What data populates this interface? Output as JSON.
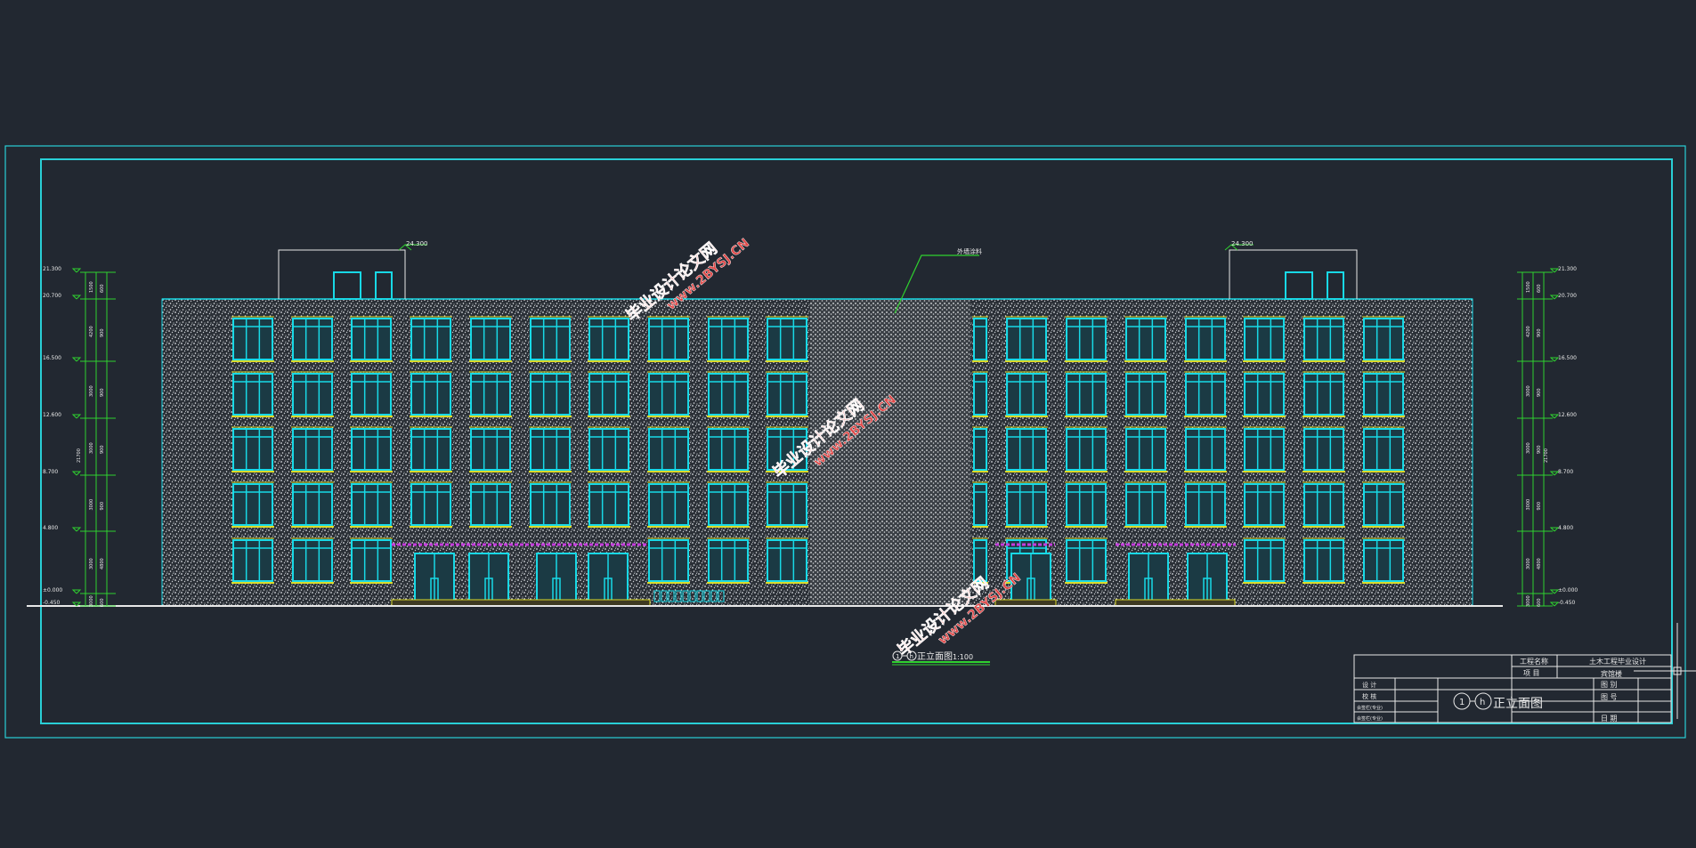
{
  "colors": {
    "background": "#222831",
    "frame": "#29cfd6",
    "wall_speckle": "#d9dde0",
    "window_frame": "#18d9e6",
    "sill": "#dada2a",
    "canopy": "#c43cdc",
    "dimension": "#2fd12f",
    "annotation_text": "#e8e8e8",
    "watermark": "#e04848"
  },
  "elevation": {
    "roof_labels": [
      "24.300",
      "24.300"
    ],
    "material_note": "外墙涂料",
    "left_levels": [
      "21.300",
      "20.700",
      "16.500",
      "12.600",
      "8.700",
      "4.800",
      "±0.000",
      "-0.450"
    ],
    "right_levels": [
      "21.300",
      "20.700",
      "16.500",
      "12.600",
      "8.700",
      "4.800",
      "±0.000",
      "-0.450"
    ],
    "left_dims": [
      "1500",
      "600",
      "4200",
      "900",
      "3000",
      "900",
      "3000",
      "900",
      "3000",
      "900",
      "3000",
      "4800",
      "3000",
      "600"
    ],
    "right_dims": [
      "1500",
      "600",
      "4200",
      "900",
      "3000",
      "900",
      "3000",
      "900",
      "3000",
      "900",
      "3000",
      "4800",
      "3000",
      "600"
    ],
    "total_dim": "21700"
  },
  "view_title": {
    "axis_start": "1",
    "axis_end": "h",
    "name": "正立面图",
    "scale": "1:100"
  },
  "title_block": {
    "project_name_label": "工程名称",
    "project_name_value": "土木工程毕业设计",
    "project_label": "项  目",
    "project_value": "宾馆楼",
    "design_label": "设  计",
    "check_label": "校  核",
    "row3": "会签栏(专业)",
    "row4": "会签栏(专业)",
    "drawing_title_start": "1",
    "drawing_title_end": "h",
    "drawing_title": "正立面图",
    "sheet_label": "图  别",
    "number_label": "图  号",
    "date_label": "日  期"
  },
  "watermarks": [
    {
      "line1": "毕业设计论文网",
      "line2": "www.2BYSJ.CN"
    },
    {
      "line1": "毕业设计论文网",
      "line2": "www.2BYSJ.CN"
    },
    {
      "line1": "毕业设计论文网",
      "line2": "www.2BYSJ.CN"
    }
  ]
}
